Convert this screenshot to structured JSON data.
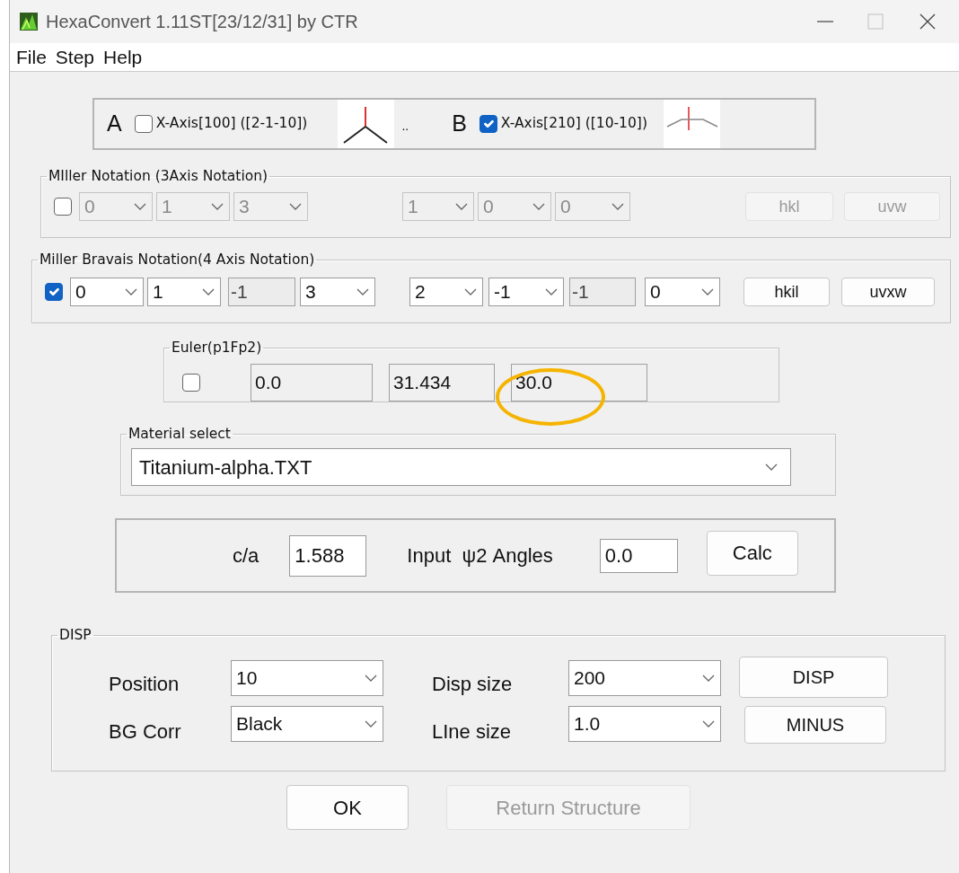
{
  "window": {
    "title": "HexaConvert 1.11ST[23/12/31] by CTR"
  },
  "menu": [
    {
      "label": "File"
    },
    {
      "label": "Step"
    },
    {
      "label": "Help"
    }
  ],
  "axis_options": [
    {
      "letter": "A",
      "label": "X-Axis[100] ([2-1-10])",
      "checked": false
    },
    {
      "letter": "B",
      "label": "X-Axis[210] ([10-10])",
      "checked": true
    }
  ],
  "axis_separator": "..",
  "miller": {
    "title": "MIller Notation (3Axis Notation)",
    "checked": false,
    "disabled": true,
    "plane": [
      {
        "kind": "combo",
        "value": "0"
      },
      {
        "kind": "combo",
        "value": "1"
      },
      {
        "kind": "combo",
        "value": "3"
      }
    ],
    "direction": [
      {
        "kind": "combo",
        "value": "1"
      },
      {
        "kind": "combo",
        "value": "0"
      },
      {
        "kind": "combo",
        "value": "0"
      }
    ],
    "buttons": [
      "hkl",
      "uvw"
    ]
  },
  "miller_bravais": {
    "title": "Miller Bravais Notation(4 Axis Notation)",
    "checked": true,
    "disabled": false,
    "plane": [
      {
        "kind": "combo",
        "value": "0"
      },
      {
        "kind": "combo",
        "value": "1"
      },
      {
        "kind": "readonly",
        "value": "-1"
      },
      {
        "kind": "combo",
        "value": "3"
      }
    ],
    "direction": [
      {
        "kind": "combo",
        "value": "2"
      },
      {
        "kind": "combo",
        "value": "-1"
      },
      {
        "kind": "readonly",
        "value": "-1"
      },
      {
        "kind": "combo",
        "value": "0"
      }
    ],
    "buttons": [
      "hkil",
      "uvxw"
    ]
  },
  "euler": {
    "title": "Euler(p1Fp2)",
    "checked": false,
    "fields": [
      {
        "value": "0.0",
        "highlighted": false
      },
      {
        "value": "31.434",
        "highlighted": false
      },
      {
        "value": "30.0",
        "highlighted": true
      }
    ]
  },
  "material": {
    "title": "Material select",
    "value": "Titanium-alpha.TXT"
  },
  "calc": {
    "ca_label": "c/a",
    "ca_value": "1.588",
    "angle_label": "Input  ψ2 Angles",
    "angle_value": "0.0",
    "button": "Calc"
  },
  "disp": {
    "title": "DISP",
    "rows": [
      {
        "label": "Position",
        "value": "10",
        "label2": "Disp size",
        "value2": "200",
        "button": "DISP"
      },
      {
        "label": "BG Corr",
        "value": "Black",
        "label2": "LIne size",
        "value2": "1.0",
        "button": "MINUS"
      }
    ]
  },
  "footer_buttons": [
    {
      "label": "OK",
      "disabled": false
    },
    {
      "label": "Return Structure",
      "disabled": true
    }
  ]
}
